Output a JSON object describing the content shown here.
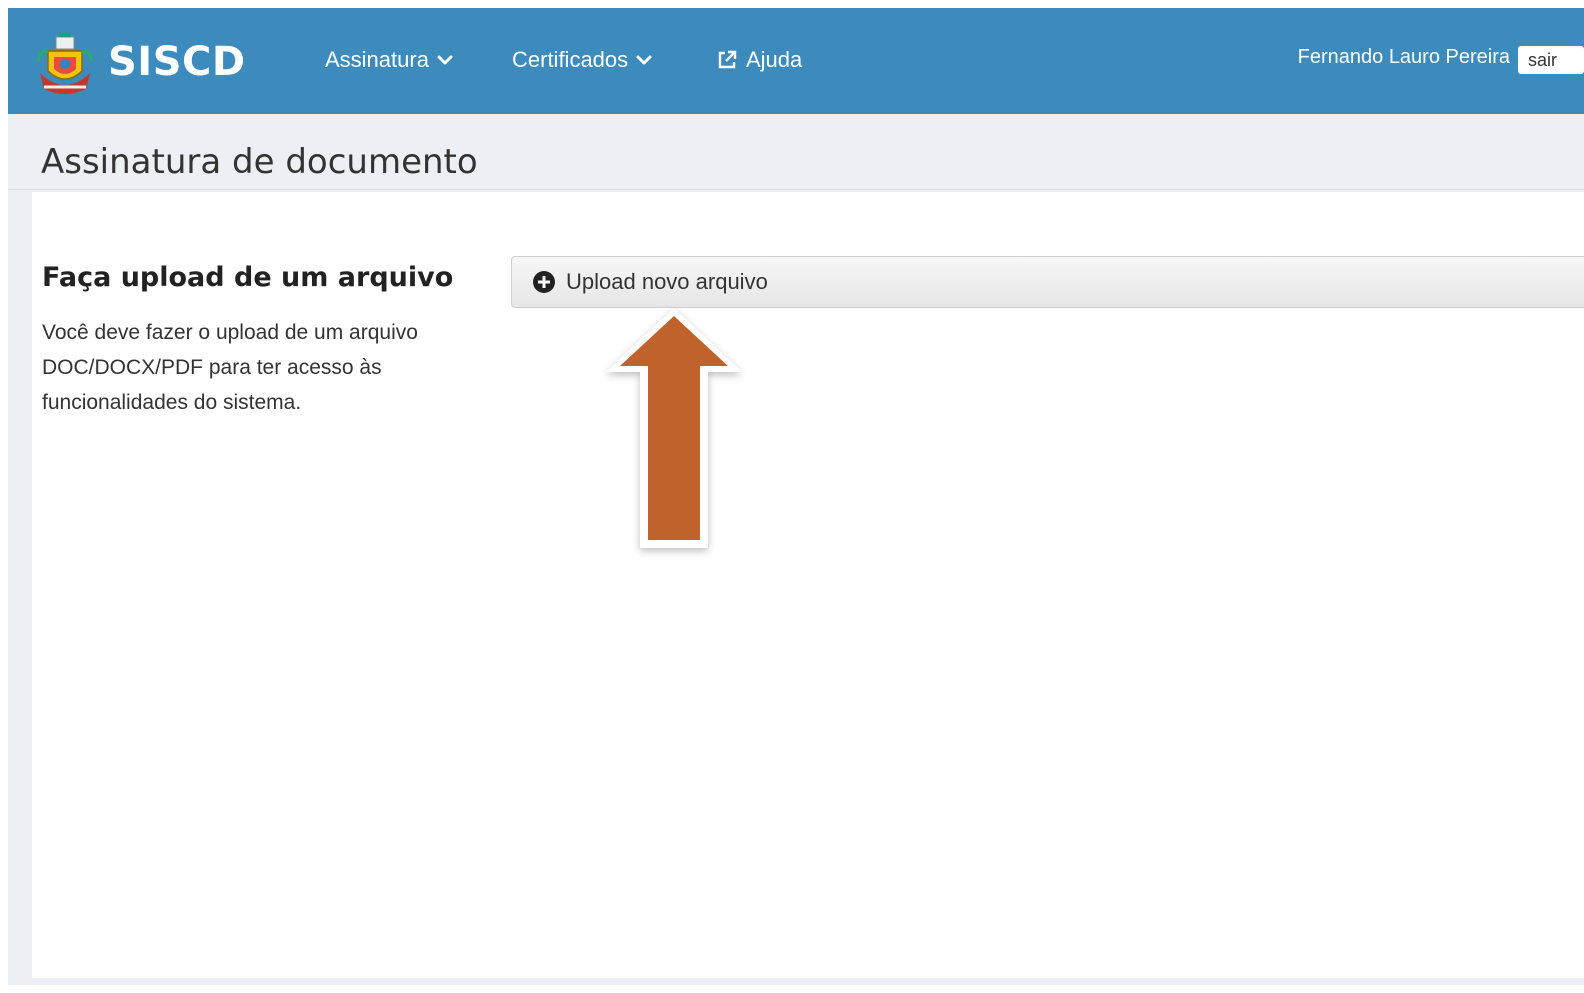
{
  "navbar": {
    "brand": "SISCD",
    "menu": [
      {
        "label": "Assinatura",
        "icon": "chevron-down-icon"
      },
      {
        "label": "Certificados",
        "icon": "chevron-down-icon"
      },
      {
        "label": "Ajuda",
        "icon": "external-link-icon"
      }
    ],
    "user_name": "Fernando Lauro Pereira",
    "logout_label": "sair",
    "color": "#3d8bbd"
  },
  "page": {
    "title": "Assinatura de documento"
  },
  "upload": {
    "title": "Faça upload de um arquivo",
    "description": "Você deve fazer o upload de um arquivo DOC/DOCX/PDF para ter acesso às funcionalidades do sistema.",
    "button_label": "Upload novo arquivo",
    "button_icon": "plus-circle-icon"
  },
  "annotation": {
    "icon": "arrow-up-icon",
    "color": "#c0622c"
  }
}
